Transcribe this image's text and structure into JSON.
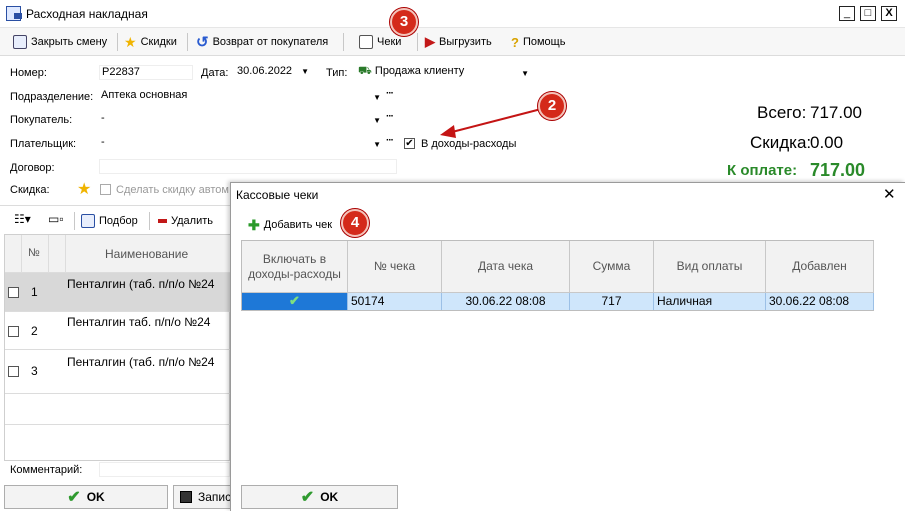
{
  "window": {
    "title": "Расходная накладная",
    "min": "_",
    "max": "□",
    "close": "X"
  },
  "toolbar": {
    "close_shift": "Закрыть смену",
    "discounts": "Скидки",
    "return": "Возврат от покупателя",
    "receipts": "Чеки",
    "export": "Выгрузить",
    "help": "Помощь"
  },
  "form": {
    "number_label": "Номер:",
    "number": "Р22837",
    "date_label": "Дата:",
    "date": "30.06.2022",
    "type_label": "Тип:",
    "type": "Продажа клиенту",
    "division_label": "Подразделение:",
    "division": "Аптека основная",
    "buyer_label": "Покупатель:",
    "buyer": "-",
    "payer_label": "Плательщик:",
    "payer": "-",
    "income_checkbox_label": "В доходы-расходы",
    "contract_label": "Договор:",
    "discount_label": "Скидка:",
    "discount_placeholder": "Сделать скидку автом",
    "comment_label": "Комментарий:"
  },
  "totals": {
    "total_label": "Всего:",
    "total": "717.00",
    "discount_label": "Скидка:",
    "discount": "0.00",
    "pay_label": "К оплате:",
    "pay": "717.00"
  },
  "badges": [
    "3",
    "2",
    "4"
  ],
  "left_toolbar": {
    "pick": "Подбор",
    "delete": "Удалить"
  },
  "left_grid": {
    "headers": {
      "num": "№",
      "name": "Наименование"
    },
    "rows": [
      {
        "n": "1",
        "name": "Пенталгин (таб. п/п/о №24"
      },
      {
        "n": "2",
        "name": "Пенталгин таб. п/п/о №24"
      },
      {
        "n": "3",
        "name": "Пенталгин (таб. п/п/о №24"
      }
    ]
  },
  "bottom": {
    "ok": "OK",
    "save": "Запис"
  },
  "dialog": {
    "title": "Кассовые чеки",
    "close": "✕",
    "add_receipt": "Добавить чек",
    "ok": "OK",
    "columns": [
      "Включать в доходы-расходы",
      "№ чека",
      "Дата чека",
      "Сумма",
      "Вид оплаты",
      "Добавлен"
    ],
    "rows": [
      {
        "included": true,
        "number": "50174",
        "date": "30.06.22 08:08",
        "sum": "717",
        "payment": "Наличная",
        "added": "30.06.22 08:08"
      }
    ]
  }
}
